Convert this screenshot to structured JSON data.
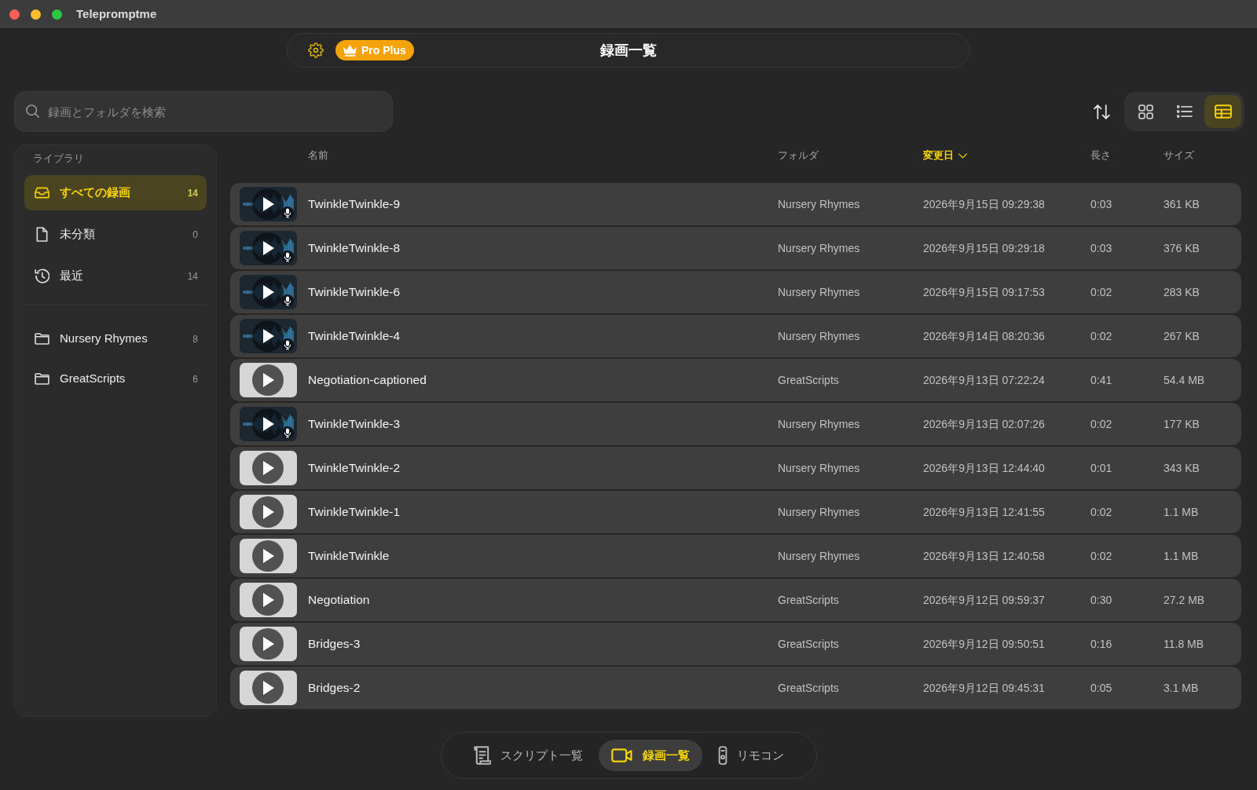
{
  "window": {
    "title": "Telepromptme"
  },
  "header": {
    "badge": "Pro Plus",
    "title": "録画一覧"
  },
  "search": {
    "placeholder": "録画とフォルダを検索"
  },
  "view_modes": [
    {
      "kind": "grid",
      "selected": false
    },
    {
      "kind": "list",
      "selected": false
    },
    {
      "kind": "table",
      "selected": true
    }
  ],
  "sidebar": {
    "section_title": "ライブラリ",
    "items": [
      {
        "kind": "all",
        "label": "すべての録画",
        "count": "14",
        "selected": true
      },
      {
        "kind": "unfiled",
        "label": "未分類",
        "count": "0",
        "selected": false
      },
      {
        "kind": "recent",
        "label": "最近",
        "count": "14",
        "selected": false
      }
    ],
    "folders": [
      {
        "label": "Nursery Rhymes",
        "count": "8",
        "selected": false
      },
      {
        "label": "GreatScripts",
        "count": "6",
        "selected": false
      }
    ]
  },
  "table": {
    "columns": [
      {
        "label": "名前",
        "sorted": false
      },
      {
        "label": "フォルダ",
        "sorted": false
      },
      {
        "label": "変更日",
        "sorted": true
      },
      {
        "label": "長さ",
        "sorted": false
      },
      {
        "label": "サイズ",
        "sorted": false
      }
    ],
    "rows": [
      {
        "kind": "audio",
        "name": "TwinkleTwinkle-9",
        "folder": "Nursery Rhymes",
        "modified": "2026年9月15日 09:29:38",
        "length": "0:03",
        "size": "361 KB"
      },
      {
        "kind": "audio",
        "name": "TwinkleTwinkle-8",
        "folder": "Nursery Rhymes",
        "modified": "2026年9月15日 09:29:18",
        "length": "0:03",
        "size": "376 KB"
      },
      {
        "kind": "audio",
        "name": "TwinkleTwinkle-6",
        "folder": "Nursery Rhymes",
        "modified": "2026年9月15日 09:17:53",
        "length": "0:02",
        "size": "283 KB"
      },
      {
        "kind": "audio",
        "name": "TwinkleTwinkle-4",
        "folder": "Nursery Rhymes",
        "modified": "2026年9月14日 08:20:36",
        "length": "0:02",
        "size": "267 KB"
      },
      {
        "kind": "video",
        "name": "Negotiation-captioned",
        "folder": "GreatScripts",
        "modified": "2026年9月13日 07:22:24",
        "length": "0:41",
        "size": "54.4 MB"
      },
      {
        "kind": "audio",
        "name": "TwinkleTwinkle-3",
        "folder": "Nursery Rhymes",
        "modified": "2026年9月13日 02:07:26",
        "length": "0:02",
        "size": "177 KB"
      },
      {
        "kind": "video",
        "name": "TwinkleTwinkle-2",
        "folder": "Nursery Rhymes",
        "modified": "2026年9月13日 12:44:40",
        "length": "0:01",
        "size": "343 KB"
      },
      {
        "kind": "video",
        "name": "TwinkleTwinkle-1",
        "folder": "Nursery Rhymes",
        "modified": "2026年9月13日 12:41:55",
        "length": "0:02",
        "size": "1.1 MB"
      },
      {
        "kind": "video",
        "name": "TwinkleTwinkle",
        "folder": "Nursery Rhymes",
        "modified": "2026年9月13日 12:40:58",
        "length": "0:02",
        "size": "1.1 MB"
      },
      {
        "kind": "video",
        "name": "Negotiation",
        "folder": "GreatScripts",
        "modified": "2026年9月12日 09:59:37",
        "length": "0:30",
        "size": "27.2 MB"
      },
      {
        "kind": "video",
        "name": "Bridges-3",
        "folder": "GreatScripts",
        "modified": "2026年9月12日 09:50:51",
        "length": "0:16",
        "size": "11.8 MB"
      },
      {
        "kind": "video",
        "name": "Bridges-2",
        "folder": "GreatScripts",
        "modified": "2026年9月12日 09:45:31",
        "length": "0:05",
        "size": "3.1 MB"
      }
    ]
  },
  "bottom_nav": [
    {
      "kind": "scripts",
      "label": "スクリプト一覧",
      "selected": false
    },
    {
      "kind": "recordings",
      "label": "録画一覧",
      "selected": true
    },
    {
      "kind": "remote",
      "label": "リモコン",
      "selected": false
    }
  ]
}
